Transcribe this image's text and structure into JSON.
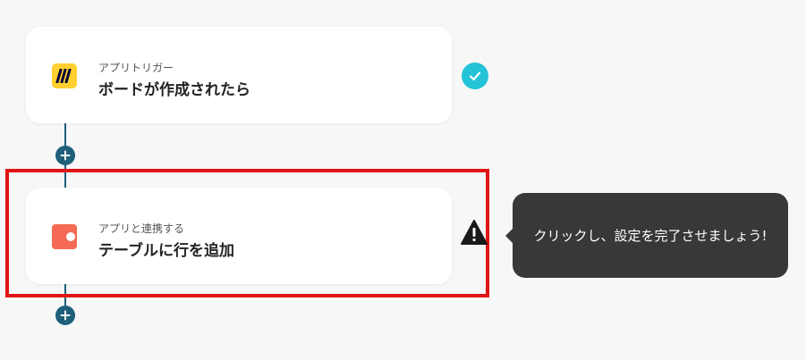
{
  "steps": [
    {
      "subtitle": "アプリトリガー",
      "title": "ボードが作成されたら",
      "app_icon": "miro-icon",
      "status": "completed"
    },
    {
      "subtitle": "アプリと連携する",
      "title": "テーブルに行を追加",
      "app_icon": "coda-icon",
      "status": "warning"
    }
  ],
  "tooltip": {
    "text": "クリックし、設定を完了させましょう!"
  },
  "colors": {
    "connector": "#1e5f7a",
    "check": "#25c3d7",
    "highlight": "#e01515",
    "tooltip_bg": "#383838",
    "miro_yellow": "#ffd02f",
    "coda_orange": "#f46a54"
  }
}
